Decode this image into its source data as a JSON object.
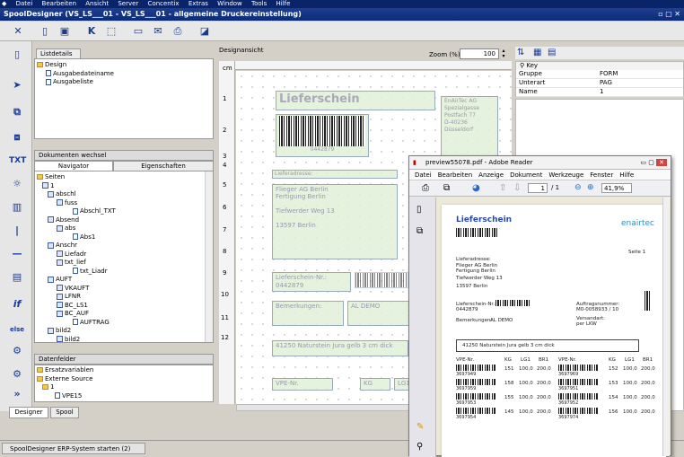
{
  "menu": [
    "Datei",
    "Bearbeiten",
    "Ansicht",
    "Server",
    "Concentix",
    "Extras",
    "Window",
    "Tools",
    "Hilfe"
  ],
  "window_title": "SpoolDesigner (VS_LS___01 - VS_LS___01 - allgemeine Druckereinstellung)",
  "listdetails": {
    "tab": "Listdetails",
    "items": [
      "Design",
      "Ausgabedateiname",
      "Ausgabeliste"
    ]
  },
  "docs": {
    "title": "Dokumenten wechsel",
    "tabs": [
      "Navigator",
      "Eigenschaften"
    ],
    "tree": [
      "Seiten",
      "1",
      "abschl",
      "fuss",
      "Abschl_TXT",
      "Absend",
      "abs",
      "Abs1",
      "Anschr",
      "Liefadr",
      "txt_lief",
      "txt_Liadr",
      "AUFT",
      "VKAUFT",
      "LFNR",
      "BC_LS1",
      "BC_AUF",
      "AUFTRAG",
      "bild2",
      "bild2"
    ]
  },
  "datenfelder": {
    "title": "Datenfelder",
    "items": [
      "Ersatzvariablen",
      "Externe Source",
      "1",
      "VPE15"
    ]
  },
  "bottom_tabs": [
    "Designer",
    "Spool"
  ],
  "design": {
    "label": "Designansicht",
    "zoom_label": "Zoom (%)",
    "zoom": "100",
    "unit": "cm",
    "rows": [
      "1",
      "2",
      "3",
      "4",
      "5",
      "6",
      "7",
      "8",
      "9",
      "10",
      "11",
      "12"
    ],
    "title": "Lieferschein",
    "barcode_num": "0442879",
    "sender": [
      "EnAirTec AG",
      "Spezialgasse",
      "Postfach 77",
      "",
      "D-40236 Düsseldorf"
    ],
    "addr_label": "Lieferadresse:",
    "addr": [
      "Flieger AG Berlin",
      "Fertigung Berlin",
      "",
      "Tiefwerder Weg 13",
      "",
      "13597 Berlin"
    ],
    "ls_label": "Lieferschein-Nr.:",
    "ls_num": "0442879",
    "bem_label": "Bemerkungen:",
    "bem": "AL DEMO",
    "line": "41250 Naturstein Jura gelb 3 cm dick",
    "hdr_vpe": "VPE-Nr.",
    "hdr_kg": "KG",
    "hdr_lg": "LG1"
  },
  "props": {
    "head": "Key",
    "rows": [
      [
        "Gruppe",
        "FORM"
      ],
      [
        "Unterart",
        "PAG"
      ],
      [
        "Name",
        "1"
      ]
    ]
  },
  "reader": {
    "title": "preview55078.pdf - Adobe Reader",
    "menu": [
      "Datei",
      "Bearbeiten",
      "Anzeige",
      "Dokument",
      "Werkzeuge",
      "Fenster",
      "Hilfe"
    ],
    "page": "1",
    "pages": "/ 1",
    "zoom": "41,9%",
    "doc": {
      "title": "Lieferschein",
      "logo": "enairtec",
      "page": "Seite 1",
      "addr_label": "Lieferadresse:",
      "addr": [
        "Flieger AG Berlin",
        "Fertigung Berlin",
        "Tiefwerder Weg 13",
        "13597 Berlin"
      ],
      "ls_label": "Lieferschein-Nr.:",
      "ls_num": "0442879",
      "auf_label": "Auftragsnummer:",
      "auf_num": "M0-0058933 / 10",
      "bem_label": "Bemerkungen:",
      "bem": "AL DEMO",
      "vers_label": "Versandart:",
      "vers": "per LKW",
      "line": "41250  Naturstein Jura gelb 3 cm dick",
      "cols": [
        "VPE-Nr.",
        "KG",
        "LG1",
        "BR1",
        "VPE-Nr.",
        "KG",
        "LG1",
        "BR1"
      ],
      "rows": [
        [
          "3697949",
          "151",
          "100,0",
          "200,0",
          "3697969",
          "152",
          "100,0",
          "200,0"
        ],
        [
          "3697959",
          "158",
          "100,0",
          "200,0",
          "3697951",
          "153",
          "100,0",
          "200,0"
        ],
        [
          "3697953",
          "155",
          "100,0",
          "200,0",
          "3697952",
          "154",
          "100,0",
          "200,0"
        ],
        [
          "3697954",
          "145",
          "100,0",
          "200,0",
          "3697974",
          "156",
          "100,0",
          "200,0"
        ]
      ]
    }
  },
  "status": "SpoolDesigner ERP-System starten (2)"
}
